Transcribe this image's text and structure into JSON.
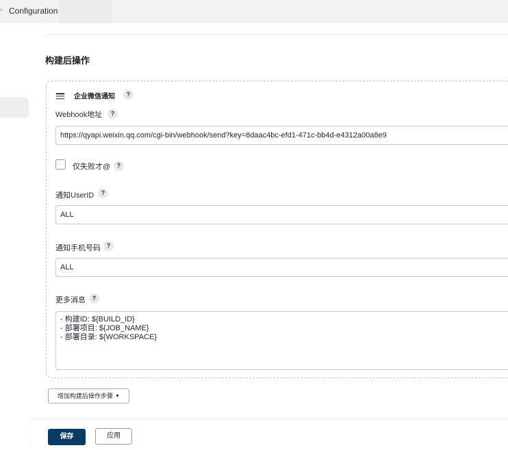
{
  "breadcrumb": {
    "separator": "›",
    "current": "Configuration"
  },
  "section": {
    "title": "构建后操作"
  },
  "wecom_notify": {
    "title": "企业微信通知",
    "help_symbol": "?",
    "webhook": {
      "label": "Webhook地址",
      "value": "https://qyapi.weixin.qq.com/cgi-bin/webhook/send?key=8daac4bc-efd1-471c-bb4d-e4312a00a8e9"
    },
    "fail_only": {
      "label": "仅失败才@",
      "checked": false
    },
    "user_id": {
      "label": "通知UserID",
      "value": "ALL"
    },
    "mobile": {
      "label": "通知手机号码",
      "value": "ALL"
    },
    "more_message": {
      "label": "更多消息",
      "value": "- 构建ID: ${BUILD_ID}\n- 部署项目: ${JOB_NAME}\n- 部署目录: ${WORKSPACE}"
    }
  },
  "actions": {
    "add_step_label": "增加构建后操作步骤",
    "add_step_caret": "▼",
    "save_label": "保存",
    "apply_label": "应用"
  },
  "icons": {
    "drag_handle": "drag-handle-icon",
    "help": "help-icon",
    "dropdown": "caret-down-icon"
  },
  "colors": {
    "primary_button": "#0b3b63",
    "card_border": "#c5c7cc",
    "topbar_bg": "#f2f2f3"
  }
}
